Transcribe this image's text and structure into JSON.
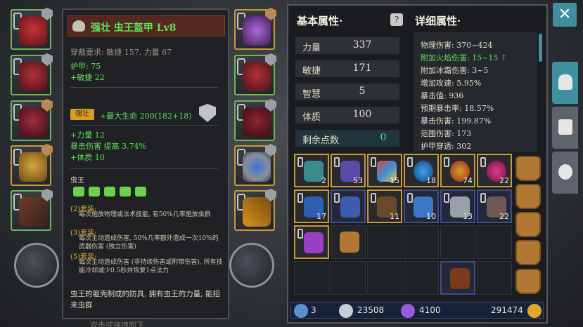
{
  "tooltip": {
    "item_name": "强壮 虫王盔甲 Lv8",
    "requirement": "穿戴要求:   敏捷 157, 力量 67",
    "armor": "护甲:  75",
    "agility_bonus": "+敏捷 22",
    "strong_tag": "强壮",
    "max_life": "+最大生命 200(182+18)",
    "str_bonus": "+力量 12",
    "crit_bonus": "暴击伤害 提高 3.74%",
    "con_bonus": "+体质 10",
    "set_name": "虫王",
    "set_2_label": "(2)套装:",
    "set_2_text": "每次施放物理或法术技能, 有50%几率施放虫群",
    "set_3_label": "(3)套装:",
    "set_3_text": "每次主动造成伤害, 50%几率额外造成一次10%的武器伤害 (独立伤害)",
    "set_5_label": "(5)套装:",
    "set_5_text": "每次主动造成伤害 (非持续伤害或附带伤害), 所有技能冷却减少0.5秒并恢复1点法力",
    "description": "虫王的躯壳制成的防具, 拥有虫王的力量, 能招来虫群",
    "bottom_hint": "双击或拖拽卸下"
  },
  "basic": {
    "title": "基本属性·",
    "stats": [
      {
        "label": "力量",
        "value": "337"
      },
      {
        "label": "敏捷",
        "value": "171"
      },
      {
        "label": "智慧",
        "value": "5"
      },
      {
        "label": "体质",
        "value": "100"
      }
    ],
    "points_label": "剩余点数",
    "points_value": "0",
    "help": "?"
  },
  "detail": {
    "title": "详细属性·",
    "lines": [
      {
        "text": "物理伤害: 370~424"
      },
      {
        "text": "附加火焰伤害: 15~15 ↑"
      },
      {
        "text": "附加冰霜伤害: 3~5"
      },
      {
        "text": "增加攻速: 5.95%"
      },
      {
        "text": "暴击值: 936"
      },
      {
        "text": "预期暴击率: 18.57%"
      },
      {
        "text": "暴击伤害: 199.87%"
      },
      {
        "text": "范围伤害: 173"
      },
      {
        "text": "护甲穿透: 302"
      }
    ]
  },
  "inventory": {
    "row1": [
      "2",
      "53",
      "15",
      "18",
      "74",
      "22"
    ],
    "row2": [
      "17",
      "",
      "11",
      "10",
      "13",
      "22"
    ]
  },
  "currency": {
    "keys": "3",
    "silver": "23508",
    "crystal": "4100",
    "gold": "291474"
  },
  "close_label": "✕"
}
